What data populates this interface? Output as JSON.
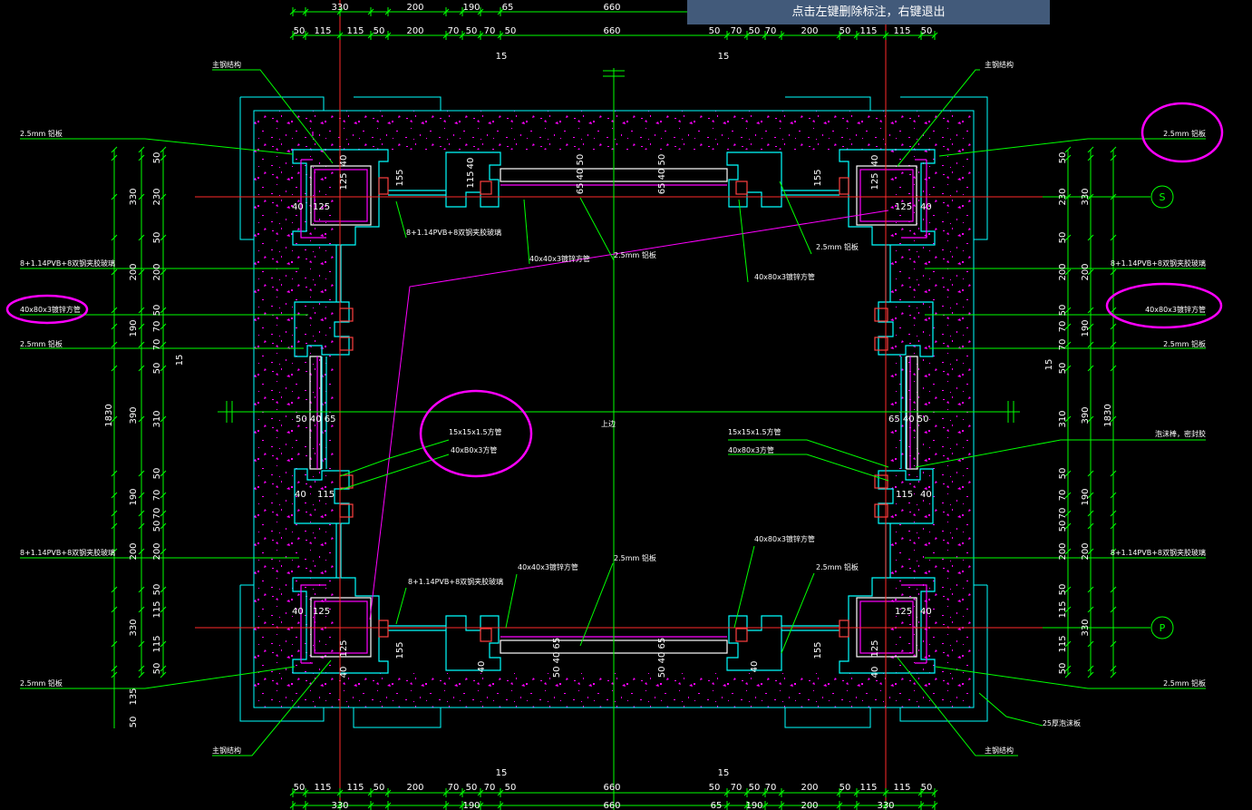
{
  "status_tooltip": "点击左键删除标注，右键退出",
  "colors": {
    "background": "#000000",
    "dim": "#00ff00",
    "frame": "#00ffff",
    "hatch": "#ff00ff",
    "axis": "#ff2a2a",
    "white": "#ffffff",
    "tooltip_bg": "#425a7a"
  },
  "dims": {
    "top_row1": [
      "330",
      "200",
      "190",
      "65",
      "660"
    ],
    "top_row2": [
      "50",
      "115",
      "115",
      "50",
      "200",
      "70",
      "50",
      "70",
      "50",
      "660",
      "50",
      "70",
      "50",
      "70",
      "200",
      "50",
      "115",
      "115",
      "50"
    ],
    "top_row3": [
      "15",
      "15"
    ],
    "bottom_row1": [
      "15",
      "15"
    ],
    "bottom_row2": [
      "50",
      "115",
      "115",
      "50",
      "200",
      "70",
      "50",
      "70",
      "50",
      "660",
      "50",
      "70",
      "50",
      "70",
      "200",
      "50",
      "115",
      "115",
      "50"
    ],
    "bottom_row3": [
      "330",
      "190",
      "660",
      "65",
      "190",
      "200",
      "330"
    ],
    "left_inner": [
      "50",
      "230",
      "50",
      "200",
      "50",
      "70",
      "70",
      "50",
      "310",
      "50",
      "70",
      "70",
      "50",
      "200",
      "50",
      "115",
      "115",
      "50"
    ],
    "left_mid": [
      "330",
      "200",
      "190",
      "390",
      "190",
      "200",
      "330",
      "135",
      "50"
    ],
    "left_outer": [
      "1830"
    ],
    "left_15": "15",
    "right_inner": [
      "50",
      "230",
      "50",
      "200",
      "50",
      "70",
      "70",
      "50",
      "310",
      "50",
      "70",
      "70",
      "50",
      "200",
      "50",
      "115",
      "115",
      "50"
    ],
    "right_mid": [
      "330",
      "200",
      "190",
      "390",
      "190",
      "200",
      "330"
    ],
    "right_outer": [
      "1830"
    ],
    "right_15": "15"
  },
  "corner_dims": {
    "v40": "40",
    "v125": "125",
    "v115": "115",
    "v155": "155",
    "h125": "125",
    "h40": "40",
    "h115": "115",
    "h40b": "40",
    "mid_left": "50 40 65",
    "mid_right": "65 40 50",
    "top_a": "65 40 50",
    "top_b": "65 40 50",
    "bot_a": "50 40 65",
    "bot_b": "50 40 65"
  },
  "labels": {
    "main_steel_tl": "主钢结构",
    "main_steel_tr": "主钢结构",
    "main_steel_bl": "主钢结构",
    "main_steel_br": "主钢结构",
    "al_tl": "2.5mm 铝板",
    "al_tr": "2.5mm 铝板",
    "glass_tl": "8+1.14PVB+8双钢夹胶玻璃",
    "glass_tr": "8+1.14PVB+8双钢夹胶玻璃",
    "tube_40x80_l": "40x80x3镀锌方管",
    "tube_40x80_r": "40x80x3镀锌方管",
    "al_ml": "2.5mm 铝板",
    "al_mr": "2.5mm 铝板",
    "glass_bl": "8+1.14PVB+8双钢夹胶玻璃",
    "glass_br": "8+1.14PVB+8双钢夹胶玻璃",
    "al_bl": "2.5mm 铝板",
    "al_br": "2.5mm 铝板",
    "foam": "25厚泡沫板",
    "sealant": "泡沫棒，密封胶",
    "c_glass_top": "8+1.14PVB+8双钢夹胶玻璃",
    "c_tube40_top": "40x40x3镀锌方管",
    "c_al_top": "2.5mm 铝板",
    "c_al_top_r": "2.5mm 铝板",
    "c_tube80_top": "40x80x3镀锌方管",
    "c_sq15_l": "15x15x1.5方管",
    "c_sq40_l": "40xB0x3方管",
    "c_sq15_r": "15x15x1.5方管",
    "c_sq40_r": "40x80x3方管",
    "c_center": "上边",
    "c_glass_bot": "8+1.14PVB+8双钢夹胶玻璃",
    "c_tube40_bot": "40x40x3镀锌方管",
    "c_al_bot": "2.5mm 铝板",
    "c_tube80_bot": "40x80x3镀锌方管",
    "c_al_bot_r": "2.5mm 铝板",
    "axis_s": "S",
    "axis_p": "P"
  }
}
